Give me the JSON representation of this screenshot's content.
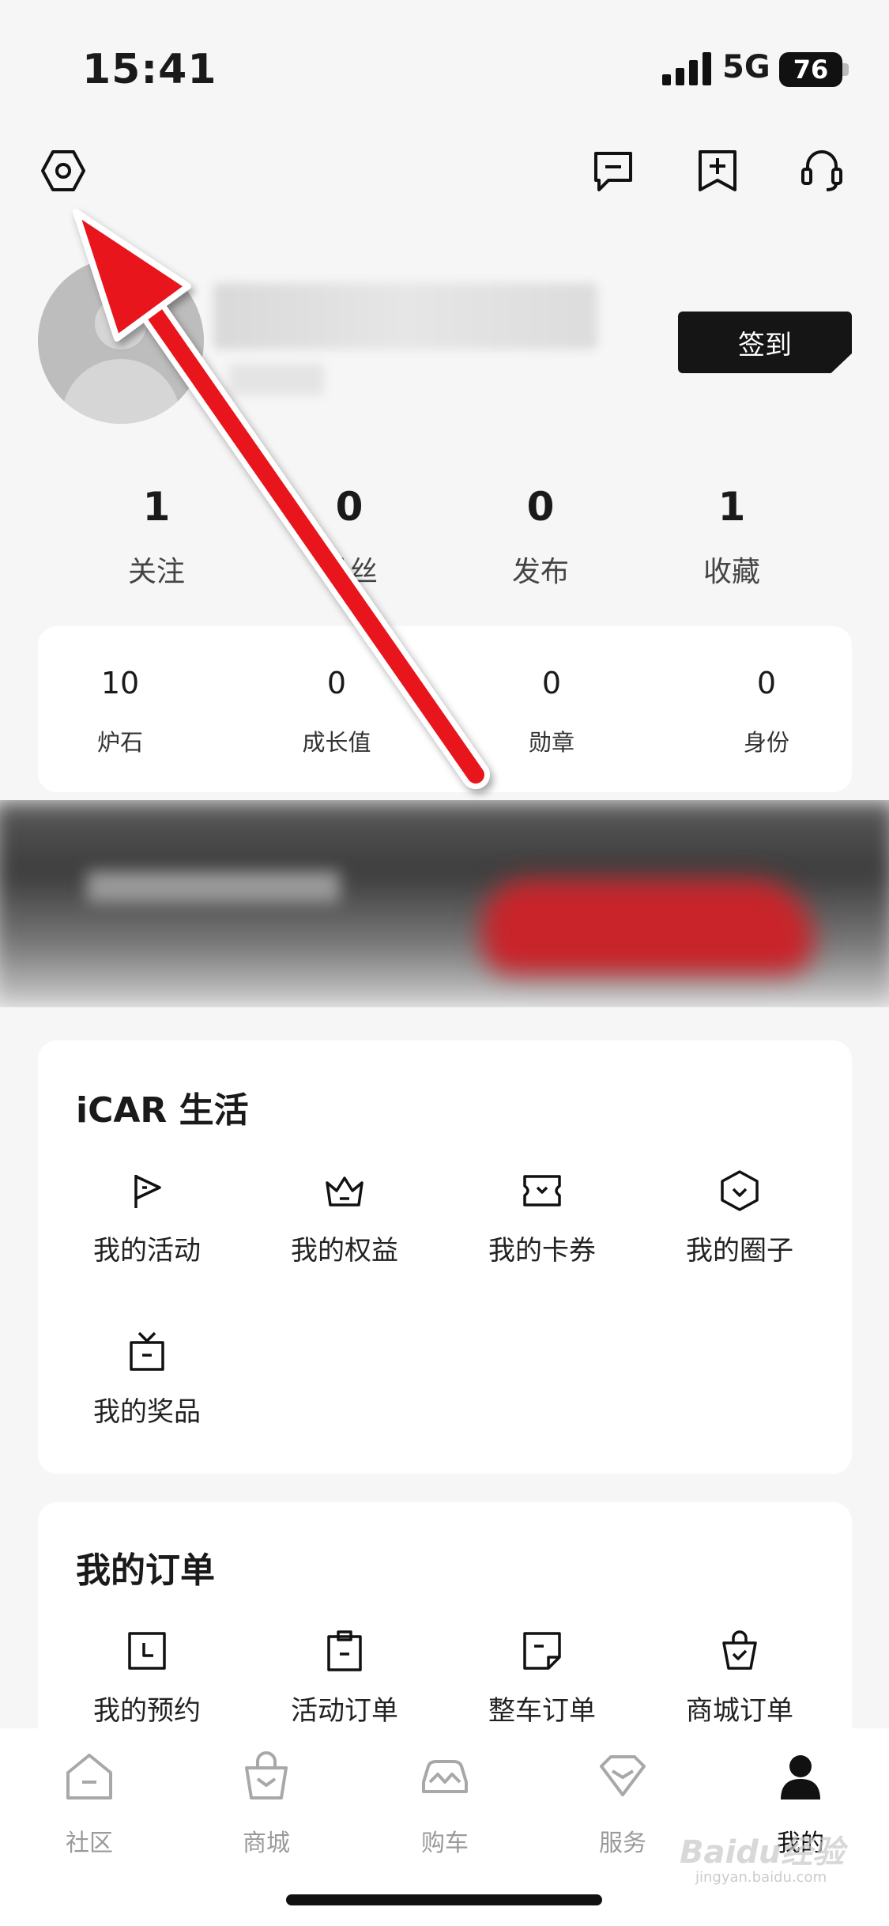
{
  "status_bar": {
    "time": "15:41",
    "network": "5G",
    "battery": "76"
  },
  "header": {
    "settings_icon": "settings-hexagon-icon",
    "actions": [
      "message-icon",
      "add-post-icon",
      "support-headset-icon"
    ]
  },
  "profile": {
    "checkin_label": "签到"
  },
  "stats": [
    {
      "num": "1",
      "label": "关注"
    },
    {
      "num": "0",
      "label": "粉丝"
    },
    {
      "num": "0",
      "label": "发布"
    },
    {
      "num": "1",
      "label": "收藏"
    }
  ],
  "mini_stats": [
    {
      "num": "10",
      "label": "炉石"
    },
    {
      "num": "0",
      "label": "成长值"
    },
    {
      "num": "0",
      "label": "勋章"
    },
    {
      "num": "0",
      "label": "身份"
    }
  ],
  "life": {
    "title": "iCAR 生活",
    "items": [
      {
        "label": "我的活动",
        "icon": "flag-icon"
      },
      {
        "label": "我的权益",
        "icon": "crown-icon"
      },
      {
        "label": "我的卡券",
        "icon": "ticket-icon"
      },
      {
        "label": "我的圈子",
        "icon": "circle-hexagon-icon"
      },
      {
        "label": "我的奖品",
        "icon": "gift-tv-icon"
      }
    ]
  },
  "orders": {
    "title": "我的订单",
    "items": [
      {
        "label": "我的预约",
        "icon": "calendar-icon"
      },
      {
        "label": "活动订单",
        "icon": "clipboard-icon"
      },
      {
        "label": "整车订单",
        "icon": "note-icon"
      },
      {
        "label": "商城订单",
        "icon": "bag-check-icon"
      }
    ]
  },
  "tabbar": [
    {
      "label": "社区",
      "icon": "home-icon",
      "active": false
    },
    {
      "label": "商城",
      "icon": "shop-bag-icon",
      "active": false
    },
    {
      "label": "购车",
      "icon": "car-icon",
      "active": false
    },
    {
      "label": "服务",
      "icon": "service-gem-icon",
      "active": false
    },
    {
      "label": "我的",
      "icon": "user-icon",
      "active": true
    }
  ],
  "watermark": {
    "text": "Baidu经验",
    "sub": "jingyan.baidu.com"
  },
  "colors": {
    "accent": "#151515",
    "annotation_arrow": "#e8141b",
    "background": "#f6f6f6"
  }
}
